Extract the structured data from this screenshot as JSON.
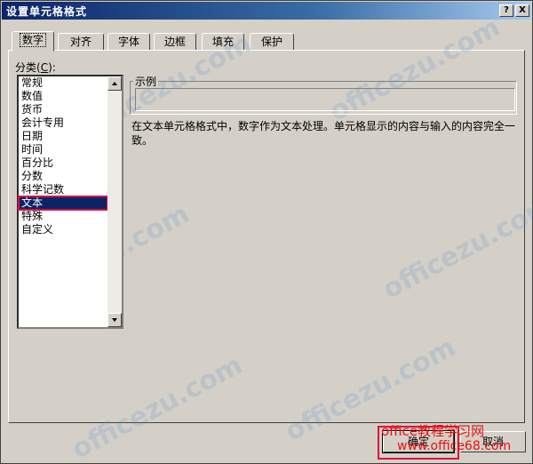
{
  "window": {
    "title": "设置单元格格式",
    "help_label": "?",
    "close_label": "X"
  },
  "tabs": [
    {
      "label": "数字",
      "active": true
    },
    {
      "label": "对齐"
    },
    {
      "label": "字体"
    },
    {
      "label": "边框"
    },
    {
      "label": "填充"
    },
    {
      "label": "保护"
    }
  ],
  "category": {
    "label_prefix": "分类(",
    "label_hotkey": "C",
    "label_suffix": "):",
    "items": [
      "常规",
      "数值",
      "货币",
      "会计专用",
      "日期",
      "时间",
      "百分比",
      "分数",
      "科学记数",
      "文本",
      "特殊",
      "自定义"
    ],
    "selected": "文本"
  },
  "sample": {
    "title": "示例",
    "value": ""
  },
  "description": "在文本单元格格式中，数字作为文本处理。单元格显示的内容与输入的内容完全一致。",
  "buttons": {
    "ok": "确定",
    "cancel": "取消"
  },
  "watermark": {
    "site": "office教程学习网",
    "url": "www.office68.com"
  }
}
